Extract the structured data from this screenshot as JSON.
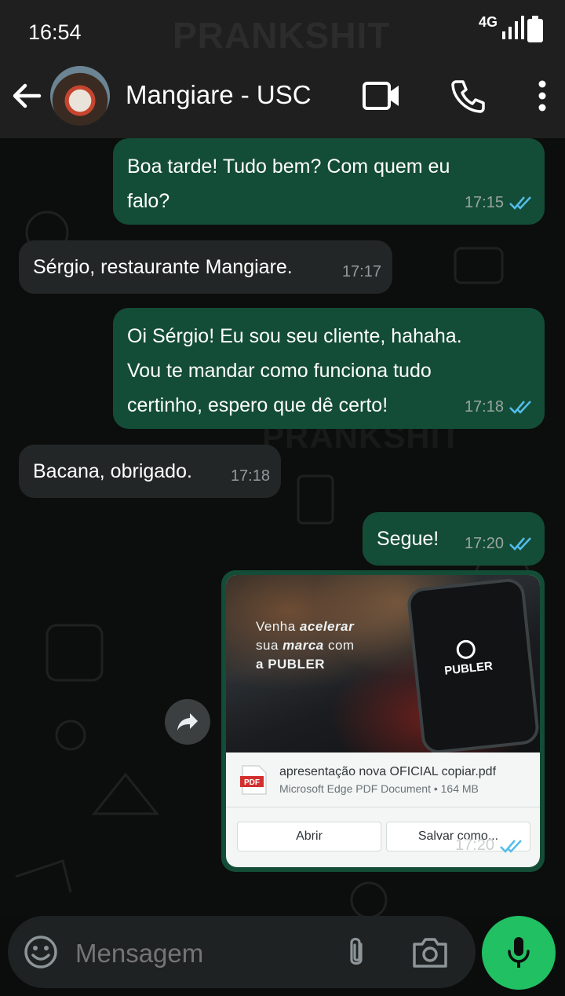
{
  "status_bar": {
    "time": "16:54",
    "network": "4G",
    "watermark": "PRANKSHIT"
  },
  "header": {
    "contact_name": "Mangiare - USC"
  },
  "chat": {
    "watermark": "PRANKSHIT",
    "messages": [
      {
        "direction": "outgoing",
        "text_lines": [
          "Boa tarde! Tudo bem? Com quem eu",
          "falo?"
        ],
        "time": "17:15",
        "read": true
      },
      {
        "direction": "incoming",
        "text_lines": [
          "Sérgio, restaurante Mangiare."
        ],
        "time": "17:17"
      },
      {
        "direction": "outgoing",
        "text_lines": [
          "Oi Sérgio! Eu sou seu cliente, hahaha.",
          "Vou te mandar como funciona tudo",
          "certinho, espero que dê certo!"
        ],
        "time": "17:18",
        "read": true
      },
      {
        "direction": "incoming",
        "text_lines": [
          "Bacana, obrigado."
        ],
        "time": "17:18"
      },
      {
        "direction": "outgoing",
        "text_lines": [
          "Segue!"
        ],
        "time": "17:20",
        "read": true
      }
    ],
    "document": {
      "preview": {
        "line1_pre": "Venha ",
        "line1_bold": "acelerar",
        "line2_pre": "sua ",
        "line2_bold": "marca",
        "line2_post": " com",
        "line3_pre": "a ",
        "line3_bold": "PUBLER",
        "phone_logo": "PUBLER"
      },
      "filename": "apresentação nova OFICIAL copiar.pdf",
      "subtitle": "Microsoft Edge PDF Document • 164 MB",
      "pdf_badge": "PDF",
      "open_label": "Abrir",
      "save_label": "Salvar como...",
      "time": "17:20",
      "read": true
    }
  },
  "input_bar": {
    "placeholder": "Mensagem"
  },
  "colors": {
    "outgoing_bubble": "#144d37",
    "incoming_bubble": "#232626",
    "read_ticks": "#53bdeb",
    "mic_button": "#21c063"
  }
}
